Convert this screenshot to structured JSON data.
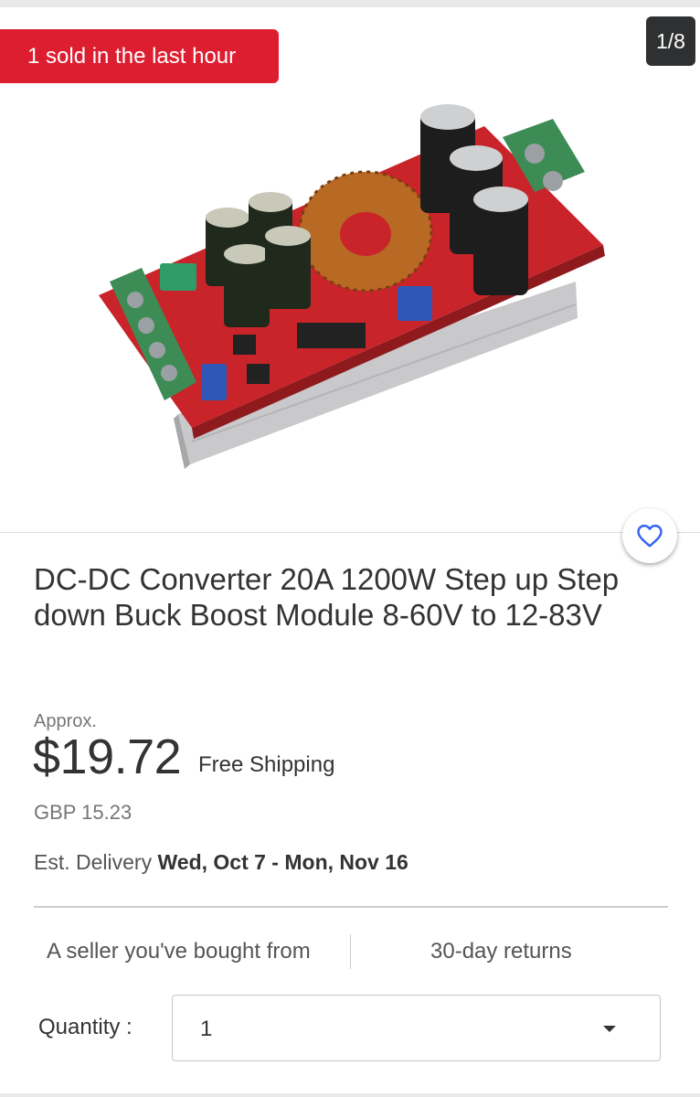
{
  "gallery": {
    "sold_banner": "1 sold in the last hour",
    "page_counter": "1/8"
  },
  "listing": {
    "title": "DC-DC Converter 20A 1200W Step up Step down Buck Boost Module 8-60V to 12-83V",
    "approx_label": "Approx.",
    "price": "$19.72",
    "shipping": "Free Shipping",
    "converted_price": "GBP 15.23",
    "delivery_label": "Est. Delivery",
    "delivery_dates": "Wed, Oct 7 - Mon, Nov 16"
  },
  "seller_info": {
    "seller_note": "A seller you've bought from",
    "returns": "30-day returns"
  },
  "quantity": {
    "label": "Quantity :",
    "value": "1"
  },
  "icons": {
    "watch": "heart-icon",
    "dropdown": "caret-down-icon"
  },
  "colors": {
    "sold_banner": "#dd1e31",
    "watch_icon": "#3665f3",
    "counter_bg": "#2f3031"
  }
}
